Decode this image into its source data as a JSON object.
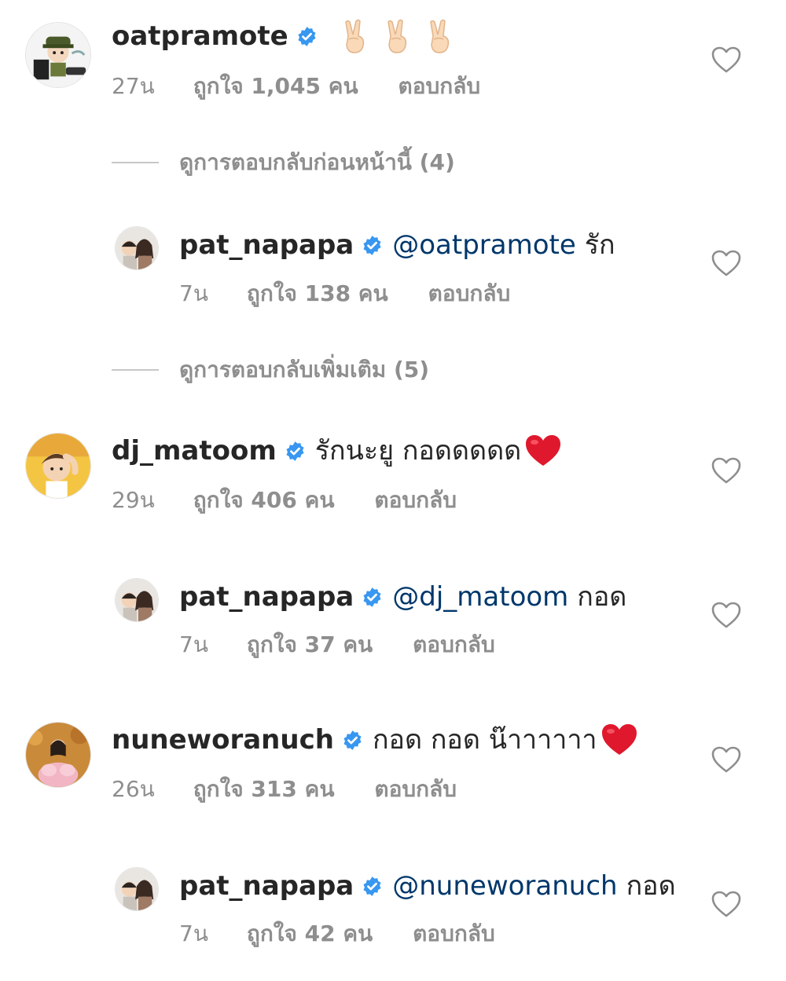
{
  "colors": {
    "text": "#262626",
    "muted": "#8e8e8e",
    "mention": "#00376b",
    "verified": "#3897f0",
    "heart_emoji": "#e0182d"
  },
  "comments": [
    {
      "username": "oatpramote",
      "text": "",
      "emoji": [
        "victory-hand",
        "victory-hand",
        "victory-hand"
      ],
      "time": "27น",
      "likes": "ถูกใจ 1,045 คน",
      "reply": "ตอบกลับ"
    },
    {
      "username": "pat_napapa",
      "mention": "@oatpramote",
      "text": "รัก",
      "time": "7น",
      "likes": "ถูกใจ 138 คน",
      "reply": "ตอบกลับ"
    },
    {
      "username": "dj_matoom",
      "text": "รักนะยู กอดดดดด",
      "emoji": [
        "red-heart"
      ],
      "time": "29น",
      "likes": "ถูกใจ 406 คน",
      "reply": "ตอบกลับ"
    },
    {
      "username": "pat_napapa",
      "mention": "@dj_matoom",
      "text": "กอด",
      "time": "7น",
      "likes": "ถูกใจ 37 คน",
      "reply": "ตอบกลับ"
    },
    {
      "username": "nuneworanuch",
      "text": "กอด กอด น๊าาาาาา",
      "emoji": [
        "red-heart"
      ],
      "time": "26น",
      "likes": "ถูกใจ 313 คน",
      "reply": "ตอบกลับ"
    },
    {
      "username": "pat_napapa",
      "mention": "@nuneworanuch",
      "text": "กอด",
      "time": "7น",
      "likes": "ถูกใจ 42 คน",
      "reply": "ตอบกลับ"
    }
  ],
  "view_previous_replies": "ดูการตอบกลับก่อนหน้านี้ (4)",
  "view_more_replies": "ดูการตอบกลับเพิ่มเติม (5)"
}
